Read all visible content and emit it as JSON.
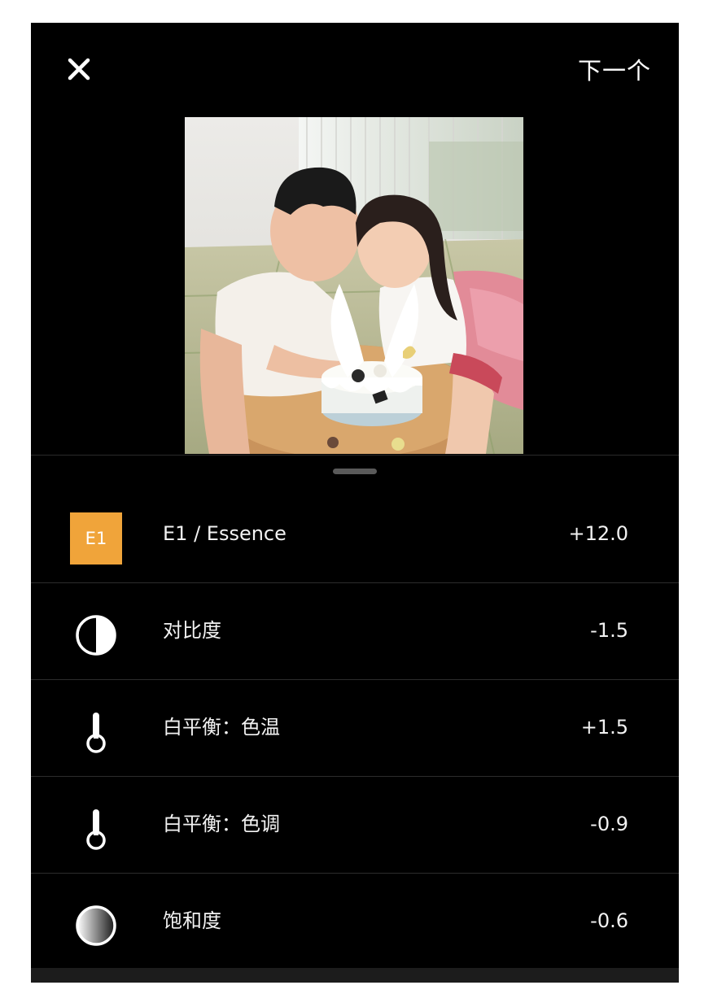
{
  "header": {
    "close_icon": "close-icon",
    "next_label": "下一个"
  },
  "photo": {
    "icon": "photo-preview"
  },
  "adjustments": [
    {
      "icon": "preset-badge",
      "badge_text": "E1",
      "label": "E1 / Essence",
      "value": "+12.0",
      "badge_color": "#f0a43a"
    },
    {
      "icon": "contrast-icon",
      "label": "对比度",
      "value": "-1.5"
    },
    {
      "icon": "thermometer-icon",
      "label": "白平衡：色温",
      "value": "+1.5"
    },
    {
      "icon": "thermometer-icon",
      "label": "白平衡：色调",
      "value": "-0.9"
    },
    {
      "icon": "saturation-icon",
      "label": "饱和度",
      "value": "-0.6"
    }
  ],
  "colors": {
    "background": "#000000",
    "text": "#f2f2f2",
    "accent": "#f0a43a"
  }
}
